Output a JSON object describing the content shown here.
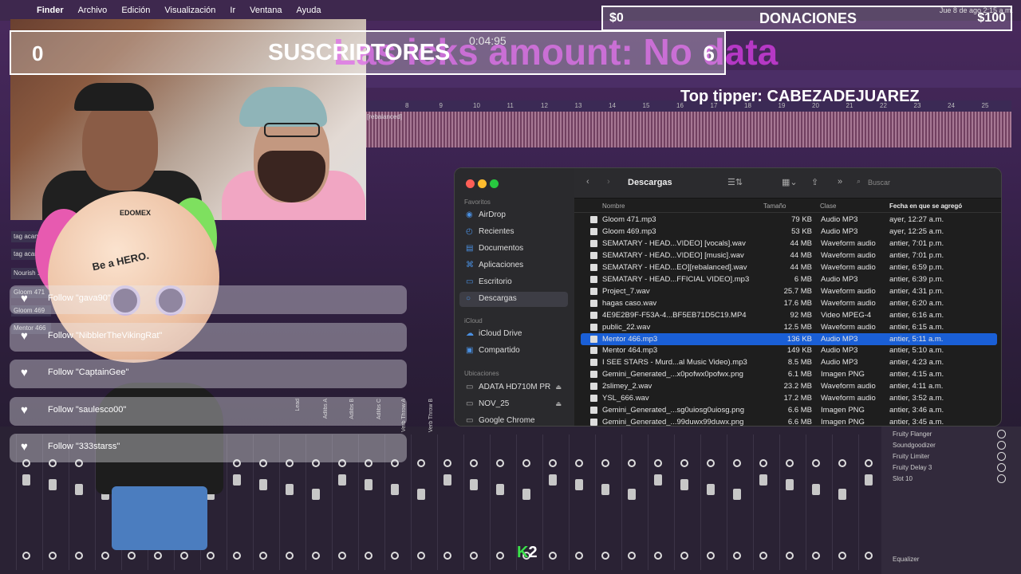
{
  "menubar": {
    "app": "Finder",
    "items": [
      "Archivo",
      "Edición",
      "Visualización",
      "Ir",
      "Ventana",
      "Ayuda"
    ],
    "clock": "Jue 8 de ago 2:15 a.m."
  },
  "daw": {
    "timeline_numbers": [
      "8",
      "9",
      "10",
      "11",
      "12",
      "13",
      "14",
      "15",
      "16",
      "17",
      "18",
      "19",
      "20",
      "21",
      "22",
      "23",
      "24",
      "25"
    ],
    "waveform_label": "[rebalanced]",
    "time_display": "0:04:95",
    "left_tracks": [
      "tag acan",
      "tag acan",
      "Nourish 1",
      "Gloom 471",
      "Gloom 469",
      "Mentor 466"
    ],
    "fx_slots": [
      "Fruity Flanger",
      "Soundgoodizer",
      "Fruity Limiter",
      "Fruity Delay 3",
      "Slot 10"
    ],
    "fx_footer": "Equalizer",
    "mixer_tracks": [
      "Lead",
      "Adlibs A",
      "Adlibs B",
      "Adlibs C",
      "Verb Throw A",
      "Verb Throw B"
    ]
  },
  "overlay": {
    "subscribers_count": "0",
    "subscribers_label": "SUSCRIPTORES",
    "subscribers_goal": "6",
    "neon_text": "Las  icks amount: No data",
    "donations_current": "$0",
    "donations_label": "DONACIONES",
    "donations_goal": "$100",
    "top_tipper": "Top tipper: CABEZADEJUAREZ",
    "k2_k": "K",
    "k2_n": "2"
  },
  "mascot": {
    "logo": "EDOMEX",
    "tagline": "Be a HERO."
  },
  "follows": [
    "Follow \"gava90\"",
    "Follow \"NibblerTheVikingRat\"",
    "Follow \"CaptainGee\"",
    "Follow \"saulesco00\"",
    "Follow \"333starss\""
  ],
  "finder": {
    "title": "Descargas",
    "search_placeholder": "Buscar",
    "sidebar": {
      "favorites_header": "Favoritos",
      "favorites": [
        "AirDrop",
        "Recientes",
        "Documentos",
        "Aplicaciones",
        "Escritorio",
        "Descargas"
      ],
      "icloud_header": "iCloud",
      "icloud": [
        "iCloud Drive",
        "Compartido"
      ],
      "locations_header": "Ubicaciones",
      "locations": [
        "ADATA HD710M PR",
        "NOV_25",
        "Google Chrome"
      ]
    },
    "columns": {
      "name": "Nombre",
      "size": "Tamaño",
      "kind": "Clase",
      "date": "Fecha en que se agregó"
    },
    "files": [
      {
        "name": "Gloom 471.mp3",
        "size": "79 KB",
        "kind": "Audio MP3",
        "date": "ayer, 12:27 a.m."
      },
      {
        "name": "Gloom 469.mp3",
        "size": "53 KB",
        "kind": "Audio MP3",
        "date": "ayer, 12:25 a.m."
      },
      {
        "name": "SEMATARY - HEAD...VIDEO] [vocals].wav",
        "size": "44 MB",
        "kind": "Waveform audio",
        "date": "antier, 7:01 p.m."
      },
      {
        "name": "SEMATARY - HEAD...VIDEO] [music].wav",
        "size": "44 MB",
        "kind": "Waveform audio",
        "date": "antier, 7:01 p.m."
      },
      {
        "name": "SEMATARY - HEAD...EO][rebalanced].wav",
        "size": "44 MB",
        "kind": "Waveform audio",
        "date": "antier, 6:59 p.m."
      },
      {
        "name": "SEMATARY - HEAD...FFICIAL VIDEO].mp3",
        "size": "6 MB",
        "kind": "Audio MP3",
        "date": "antier, 6:39 p.m."
      },
      {
        "name": "Project_7.wav",
        "size": "25.7 MB",
        "kind": "Waveform audio",
        "date": "antier, 4:31 p.m."
      },
      {
        "name": "hagas caso.wav",
        "size": "17.6 MB",
        "kind": "Waveform audio",
        "date": "antier, 6:20 a.m."
      },
      {
        "name": "4E9E2B9F-F53A-4...BF5EB71D5C19.MP4",
        "size": "92 MB",
        "kind": "Video MPEG-4",
        "date": "antier, 6:16 a.m."
      },
      {
        "name": "public_22.wav",
        "size": "12.5 MB",
        "kind": "Waveform audio",
        "date": "antier, 6:15 a.m."
      },
      {
        "name": "Mentor 466.mp3",
        "size": "136 KB",
        "kind": "Audio MP3",
        "date": "antier, 5:11 a.m."
      },
      {
        "name": "Mentor 464.mp3",
        "size": "149 KB",
        "kind": "Audio MP3",
        "date": "antier, 5:10 a.m."
      },
      {
        "name": "I SEE STARS - Murd...al Music Video).mp3",
        "size": "8.5 MB",
        "kind": "Audio MP3",
        "date": "antier, 4:23 a.m."
      },
      {
        "name": "Gemini_Generated_...x0pofwx0pofwx.png",
        "size": "6.1 MB",
        "kind": "Imagen PNG",
        "date": "antier, 4:15 a.m."
      },
      {
        "name": "2slimey_2.wav",
        "size": "23.2 MB",
        "kind": "Waveform audio",
        "date": "antier, 4:11 a.m."
      },
      {
        "name": "YSL_666.wav",
        "size": "17.2 MB",
        "kind": "Waveform audio",
        "date": "antier, 3:52 a.m."
      },
      {
        "name": "Gemini_Generated_...sg0uiosg0uiosg.png",
        "size": "6.6 MB",
        "kind": "Imagen PNG",
        "date": "antier, 3:46 a.m."
      },
      {
        "name": "Gemini_Generated_...99duwx99duwx.png",
        "size": "6.6 MB",
        "kind": "Imagen PNG",
        "date": "antier, 3:45 a.m."
      }
    ],
    "selected_file": "Mentor 466.mp3"
  }
}
